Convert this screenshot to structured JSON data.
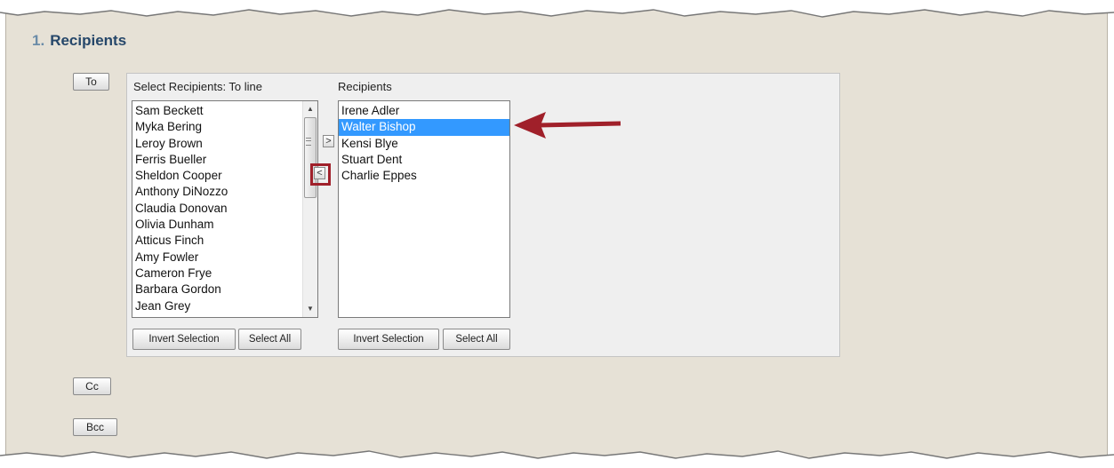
{
  "section": {
    "number": "1.",
    "title": "Recipients"
  },
  "buttons": {
    "to": "To",
    "cc": "Cc",
    "bcc": "Bcc"
  },
  "available": {
    "label": "Select Recipients: To line",
    "items": [
      "Sam Beckett",
      "Myka Bering",
      "Leroy Brown",
      "Ferris Bueller",
      "Sheldon Cooper",
      "Anthony DiNozzo",
      "Claudia Donovan",
      "Olivia Dunham",
      "Atticus Finch",
      "Amy Fowler",
      "Cameron Frye",
      "Barbara Gordon",
      "Jean Grey"
    ],
    "invert_label": "Invert Selection",
    "select_all_label": "Select All"
  },
  "move": {
    "add_symbol": ">",
    "remove_symbol": "<"
  },
  "selected": {
    "label": "Recipients",
    "items": [
      "Irene Adler",
      "Walter Bishop",
      "Kensi Blye",
      "Stuart Dent",
      "Charlie Eppes"
    ],
    "selected_item": "Walter Bishop",
    "invert_label": "Invert Selection",
    "select_all_label": "Select All"
  },
  "colors": {
    "highlight": "#3399ff",
    "annotation": "#a0202a",
    "section_title": "#26476a"
  }
}
